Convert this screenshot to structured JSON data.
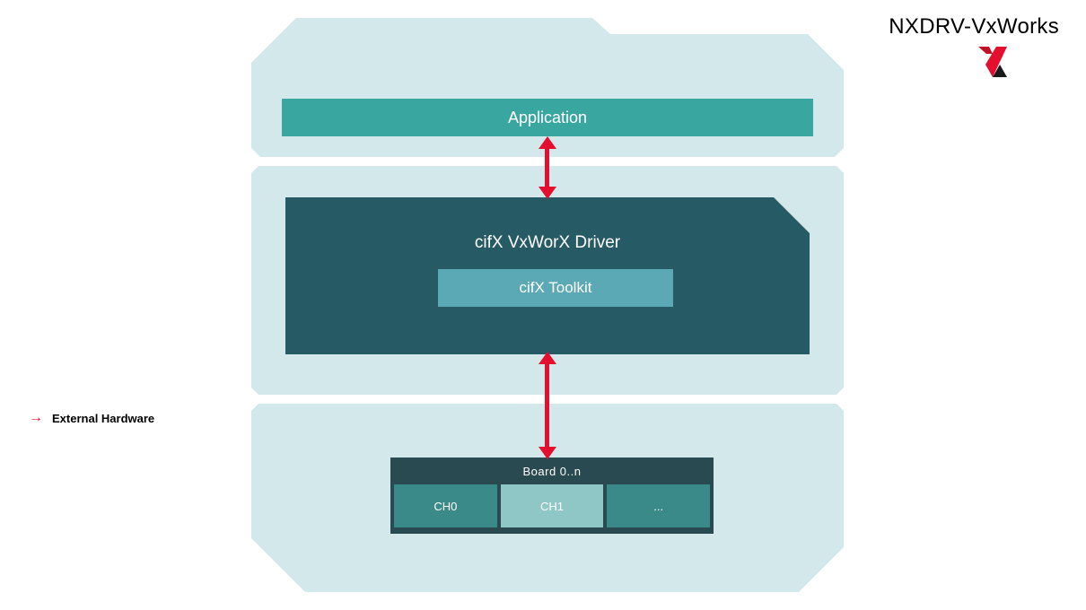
{
  "title": "NXDRV-VxWorks",
  "caption": "External Hardware",
  "blocks": {
    "application": "Application",
    "driver": "cifX VxWorX Driver",
    "toolkit": "cifX Toolkit",
    "board_header": "Board 0..n",
    "channels": [
      "CH0",
      "CH1",
      "..."
    ]
  },
  "colors": {
    "panel": "#d2e8eb",
    "app_bar": "#3aa6a0",
    "driver_box": "#265b66",
    "toolkit_bar": "#5aa9b4",
    "board_box": "#284a50",
    "arrow": "#e40f2f"
  }
}
